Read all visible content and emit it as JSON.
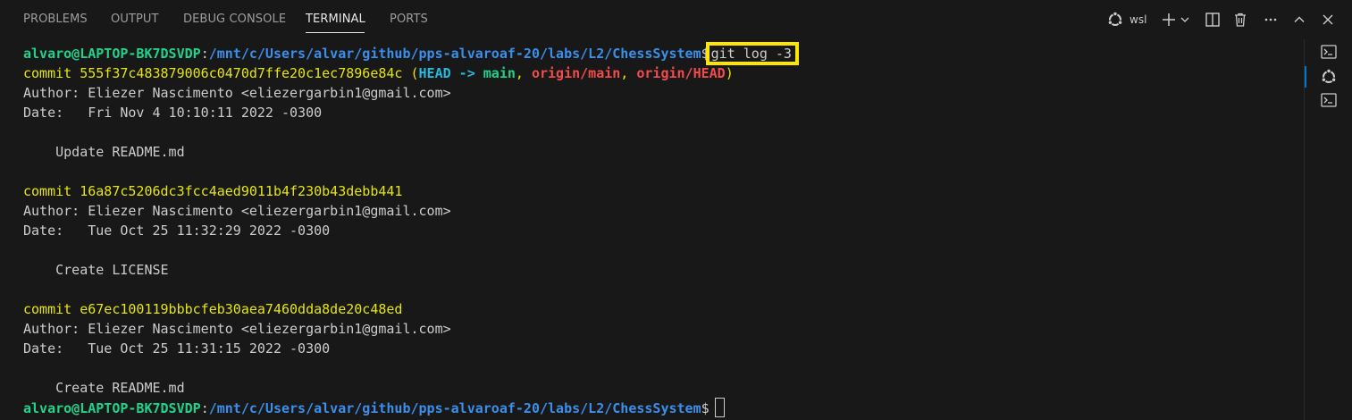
{
  "tabs": [
    {
      "label": "PROBLEMS"
    },
    {
      "label": "OUTPUT"
    },
    {
      "label": "DEBUG CONSOLE"
    },
    {
      "label": "TERMINAL"
    },
    {
      "label": "PORTS"
    }
  ],
  "toolbar": {
    "profile_label": "wsl",
    "profile_icon": "ubuntu-icon",
    "add_icon": "plus-icon",
    "dropdown_icon": "chevron-down-icon",
    "split_icon": "split-terminal-icon",
    "kill_icon": "trash-icon",
    "more_icon": "ellipsis-icon",
    "maximize_icon": "chevron-up-icon",
    "close_icon": "close-icon"
  },
  "terminal": {
    "prompt_user": "alvaro@LAPTOP-BK7DSVDP",
    "prompt_sep": ":",
    "prompt_path": "/mnt/c/Users/alvar/github/pps-alvaroaf-20/labs/L2/ChessSystem",
    "prompt_symbol": "$",
    "command": "git log -3",
    "commits": [
      {
        "commit_line": "commit 555f37c483879006c0470d7ffe20c1ec7896e84c",
        "refs_open": " (",
        "ref_head": "HEAD -> ",
        "ref_main": "main",
        "ref_sep1": ", ",
        "ref_origin_main": "origin/main",
        "ref_sep2": ", ",
        "ref_origin_head": "origin/HEAD",
        "refs_close": ")",
        "author": "Author: Eliezer Nascimento <eliezergarbin1@gmail.com>",
        "date": "Date:   Fri Nov 4 10:10:11 2022 -0300",
        "message": "    Update README.md"
      },
      {
        "commit_line": "commit 16a87c5206dc3fcc4aed9011b4f230b43debb441",
        "author": "Author: Eliezer Nascimento <eliezergarbin1@gmail.com>",
        "date": "Date:   Tue Oct 25 11:32:29 2022 -0300",
        "message": "    Create LICENSE"
      },
      {
        "commit_line": "commit e67ec100119bbbcfeb30aea7460dda8de20c48ed",
        "author": "Author: Eliezer Nascimento <eliezergarbin1@gmail.com>",
        "date": "Date:   Tue Oct 25 11:31:15 2022 -0300",
        "message": "    Create README.md"
      }
    ]
  },
  "sidebar": {
    "items": [
      {
        "icon": "terminal-icon"
      },
      {
        "icon": "ubuntu-icon"
      },
      {
        "icon": "terminal-icon"
      }
    ]
  },
  "colors": {
    "background": "#181818",
    "prompt_user": "#23d18b",
    "prompt_path": "#3b8eea",
    "commit_hash": "#e5e510",
    "ref_head": "#29b8db",
    "ref_branch": "#23d18b",
    "ref_remote": "#f14c4c",
    "highlight_box": "#ffe600"
  }
}
